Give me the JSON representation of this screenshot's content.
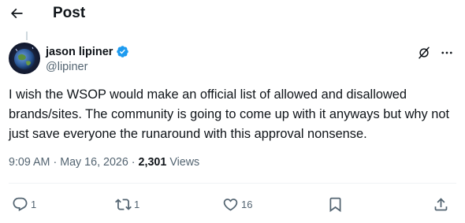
{
  "header": {
    "title": "Post",
    "back_icon": "arrow-left-icon"
  },
  "author": {
    "display_name": "jason lipiner",
    "handle": "@lipiner",
    "verified": true,
    "verified_color": "#1d9bf0"
  },
  "post": {
    "text": "I wish the WSOP would make an official list of allowed and disallowed brands/sites. The community is going to come up with it anyways but why not just save everyone the runaround with this approval nonsense.",
    "time": "9:09 AM",
    "separator1": " · ",
    "date": "May 16, 2026",
    "separator2": " · ",
    "views_count": "2,301",
    "views_label": "Views"
  },
  "actions": {
    "replies": "1",
    "reposts": "1",
    "likes": "16"
  },
  "icons": [
    "arrow-left-icon",
    "verified-badge-icon",
    "grok-icon",
    "more-icon",
    "reply-icon",
    "repost-icon",
    "like-icon",
    "bookmark-icon",
    "share-icon"
  ],
  "colors": {
    "text": "#0f1419",
    "secondary": "#536471",
    "accent": "#1d9bf0"
  }
}
